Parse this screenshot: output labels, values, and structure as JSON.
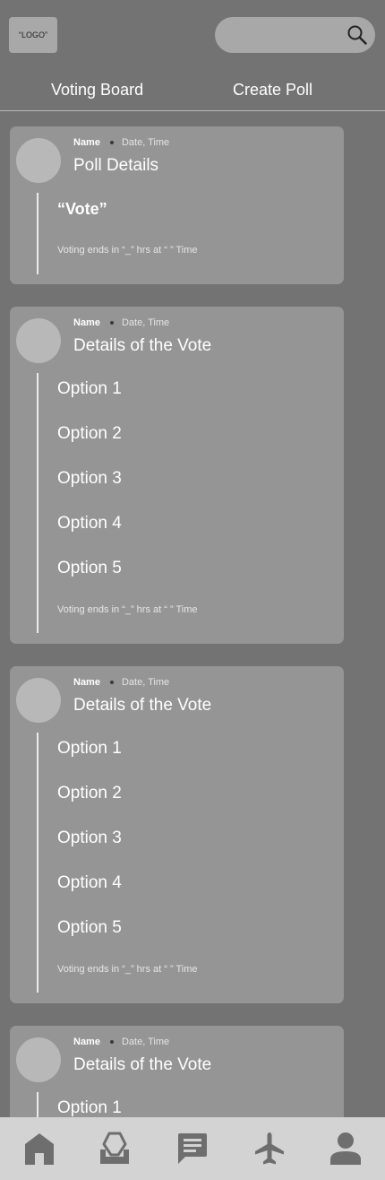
{
  "header": {
    "logo_text": "“LOGO”",
    "search_placeholder": ""
  },
  "tabs": [
    {
      "label": "Voting Board"
    },
    {
      "label": "Create Poll"
    }
  ],
  "cards": [
    {
      "name": "Name",
      "datetime": "Date, Time",
      "title": "Poll Details",
      "vote_label": "“Vote”",
      "ends": "Voting ends in “_” hrs at “ ” Time"
    },
    {
      "name": "Name",
      "datetime": "Date, Time",
      "title": "Details of the Vote",
      "options": [
        "Option 1",
        "Option 2",
        "Option 3",
        "Option 4",
        "Option 5"
      ],
      "ends": "Voting ends in “_” hrs at “ ” Time"
    },
    {
      "name": "Name",
      "datetime": "Date, Time",
      "title": "Details of the Vote",
      "options": [
        "Option 1",
        "Option 2",
        "Option 3",
        "Option 4",
        "Option 5"
      ],
      "ends": "Voting ends in “_” hrs at “ ” Time"
    },
    {
      "name": "Name",
      "datetime": "Date, Time",
      "title": "Details of the Vote",
      "options": [
        "Option 1"
      ]
    }
  ],
  "bottom_nav": [
    {
      "icon": "home-icon"
    },
    {
      "icon": "ballot-box-icon"
    },
    {
      "icon": "chat-icon"
    },
    {
      "icon": "airplane-icon"
    },
    {
      "icon": "profile-icon"
    }
  ],
  "colors": {
    "background": "#737373",
    "card": "#959595",
    "avatar": "#b8b8b8",
    "nav_bar": "#d3d3d3",
    "nav_icon": "#6e6e6e"
  }
}
